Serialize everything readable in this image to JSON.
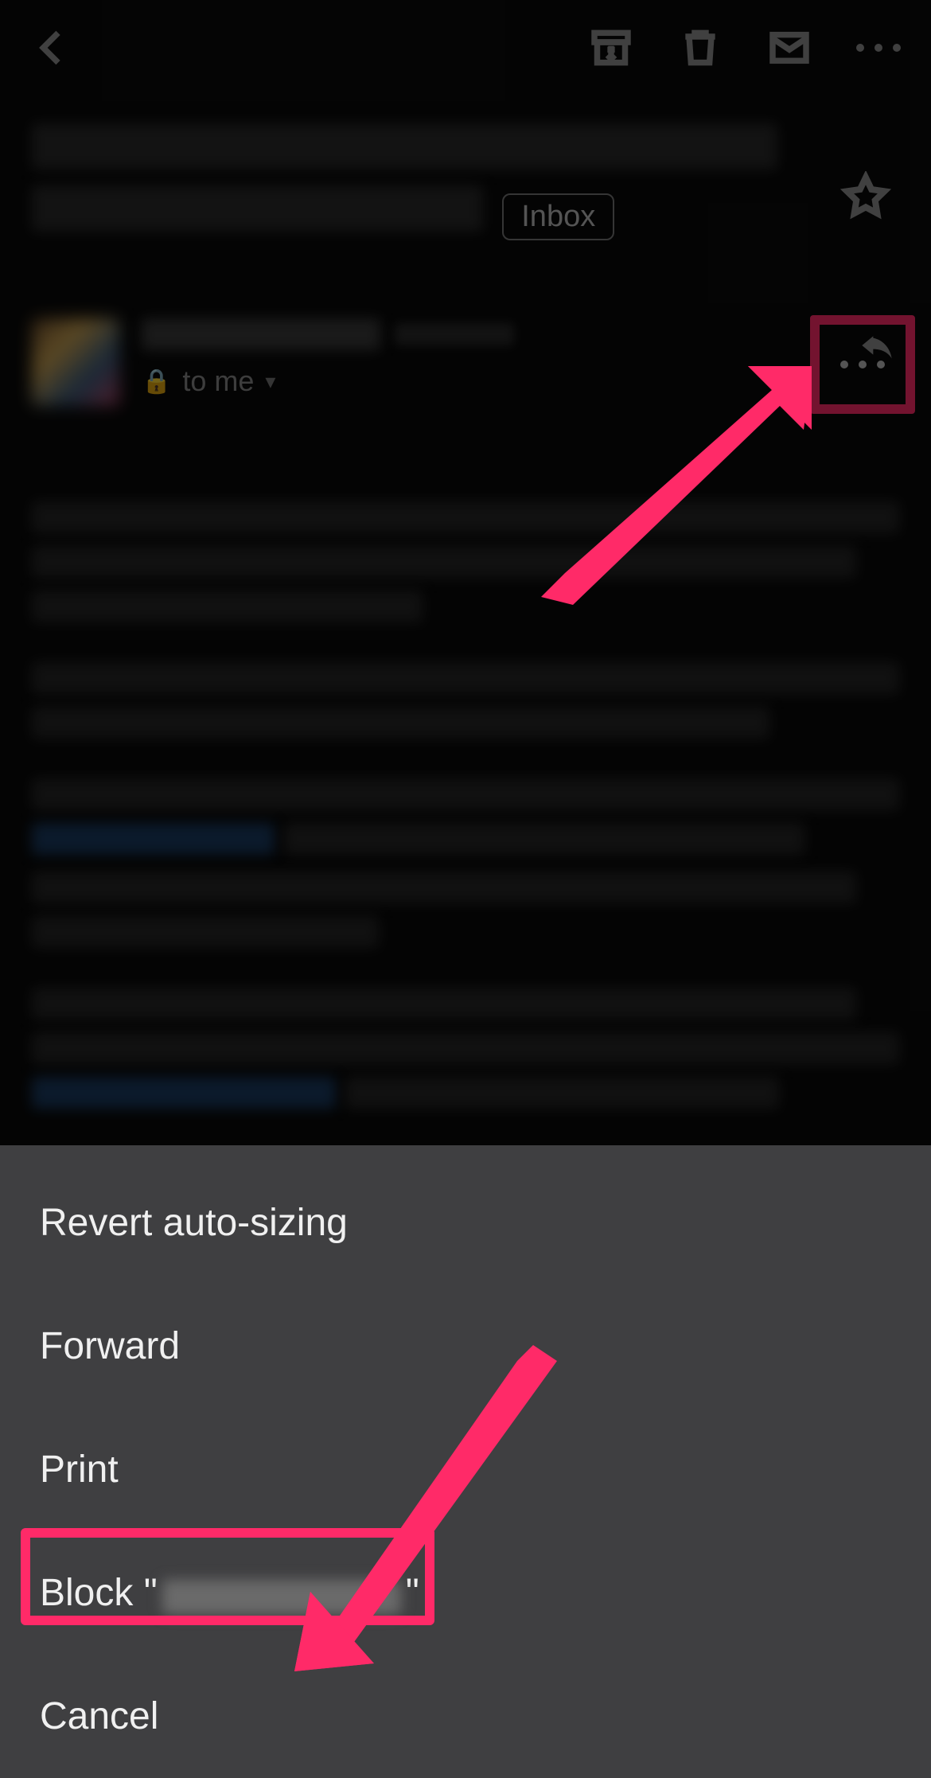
{
  "toolbar": {
    "back_icon": "back-icon",
    "archive_icon": "archive-icon",
    "delete_icon": "trash-icon",
    "mail_icon": "mail-icon",
    "more_icon": "more-icon"
  },
  "subject": {
    "chip_label": "Inbox"
  },
  "sender": {
    "to_label": "to me",
    "reply_icon": "reply-icon",
    "more_icon": "more-icon"
  },
  "sheet": {
    "items": [
      {
        "label": "Revert auto-sizing"
      },
      {
        "label": "Forward"
      },
      {
        "label": "Print"
      },
      {
        "label_prefix": "Block \"",
        "label_suffix": "\""
      },
      {
        "label": "Cancel"
      }
    ]
  },
  "annotation": {
    "highlight_color": "#ff2a68"
  }
}
